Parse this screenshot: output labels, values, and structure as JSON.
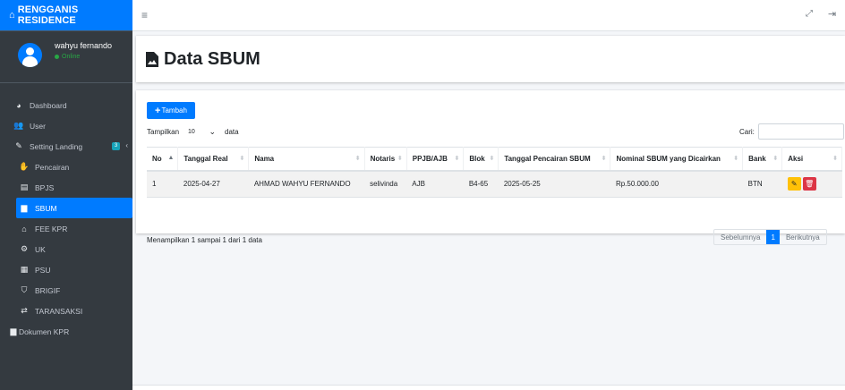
{
  "brand": {
    "name": "RENGGANIS RESIDENCE",
    "icon": "home-icon"
  },
  "user": {
    "name": "wahyu fernando",
    "status": "Online"
  },
  "sidebar": {
    "items": [
      {
        "label": "Dashboard",
        "icon": "tachometer-icon"
      },
      {
        "label": "User",
        "icon": "users-icon"
      },
      {
        "label": "Setting Landing",
        "icon": "edit-icon",
        "badge": "3"
      },
      {
        "label": "Pencairan",
        "icon": "hand-holding-dollar-icon"
      },
      {
        "label": "BPJS",
        "icon": "clipboard-icon"
      },
      {
        "label": "SBUM",
        "icon": "file-icon"
      },
      {
        "label": "FEE KPR",
        "icon": "home-icon"
      },
      {
        "label": "UK",
        "icon": "cogs-icon"
      },
      {
        "label": "PSU",
        "icon": "building-icon"
      },
      {
        "label": "BRIGIF",
        "icon": "shield-icon"
      },
      {
        "label": "TARANSAKSI",
        "icon": "exchange-icon"
      },
      {
        "label": "Dokumen KPR",
        "icon": "file-icon"
      }
    ]
  },
  "page": {
    "title": "Data SBUM"
  },
  "toolbar": {
    "add_label": "Tambah",
    "length_prefix": "Tampilkan",
    "length_value": "10",
    "length_suffix": "data",
    "search_label": "Cari:",
    "search_value": ""
  },
  "table": {
    "columns": [
      "No",
      "Tanggal Real",
      "Nama",
      "Notaris",
      "PPJB/AJB",
      "Blok",
      "Tanggal Pencairan SBUM",
      "Nominal SBUM yang Dicairkan",
      "Bank",
      "Aksi"
    ],
    "rows": [
      [
        "1",
        "2025-04-27",
        "AHMAD WAHYU FERNANDO",
        "selivinda",
        "AJB",
        "B4-65",
        "2025-05-25",
        "Rp.50.000.00",
        "BTN"
      ]
    ]
  },
  "footer": {
    "info": "Menampilkan 1 sampai 1 dari 1 data",
    "prev": "Sebelumnya",
    "current": "1",
    "next": "Berikutnya"
  },
  "colors": {
    "primary": "#007bff",
    "sidebar": "#343a40",
    "warning": "#ffc107",
    "danger": "#dc3545",
    "online": "#28a745"
  }
}
